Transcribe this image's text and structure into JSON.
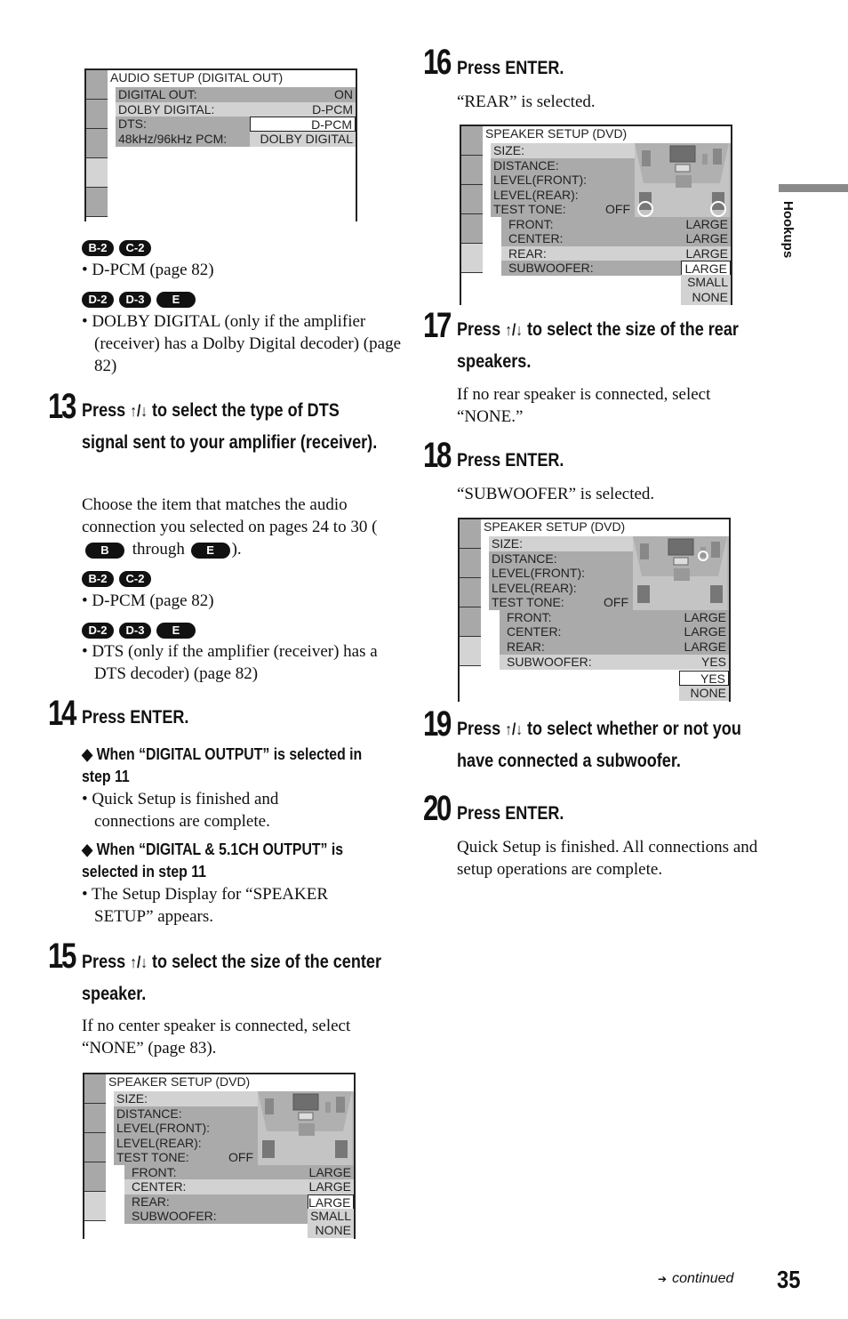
{
  "page": {
    "section_tab": "Hookups",
    "page_number": "35",
    "continued": "continued",
    "continued_arrow": "➔"
  },
  "osd_audio": {
    "title": "AUDIO SETUP (DIGITAL OUT)",
    "rows": [
      {
        "label": "DIGITAL OUT:",
        "value": "ON"
      },
      {
        "label": "DOLBY DIGITAL:",
        "value": "D-PCM"
      },
      {
        "label": "DTS:",
        "value": "D-PCM"
      },
      {
        "label": "48kHz/96kHz PCM:",
        "value": "DOLBY DIGITAL"
      }
    ]
  },
  "left_intro": {
    "group1_badges": [
      "B-2",
      "C-2"
    ],
    "group1_text": "• D-PCM (page 82)",
    "group2_badges": [
      "D-2",
      "D-3",
      "E"
    ],
    "group2_text": "• DOLBY DIGITAL (only if the amplifier (receiver) has a Dolby Digital decoder) (page 82)"
  },
  "step13": {
    "num": "13",
    "heading_pre": "Press ",
    "arrows": "↑/↓",
    "heading_post": " to select the type of DTS signal sent to your amplifier (receiver).",
    "body_pre": "Choose the item that matches the audio connection you selected on pages 24 to 30 (",
    "badge_from": "B",
    "body_mid": " through ",
    "badge_to": "E",
    "body_post": ").",
    "group1_badges": [
      "B-2",
      "C-2"
    ],
    "group1_text": "• D-PCM (page 82)",
    "group2_badges": [
      "D-2",
      "D-3",
      "E"
    ],
    "group2_text": "• DTS (only if the amplifier (receiver) has a DTS decoder) (page 82)"
  },
  "step14": {
    "num": "14",
    "heading": "Press ENTER.",
    "case1_head": "◆ When “DIGITAL OUTPUT” is selected in step 11",
    "case1_text": "• Quick Setup is finished and connections are complete.",
    "case2_head": "◆ When “DIGITAL & 5.1CH OUTPUT” is selected in step 11",
    "case2_text": "• The Setup Display for “SPEAKER SETUP” appears."
  },
  "step15": {
    "num": "15",
    "heading_pre": "Press ",
    "arrows": "↑/↓",
    "heading_post": " to select the size of the center speaker.",
    "body": "If no center speaker is connected, select “NONE” (page 83)."
  },
  "osd_speaker_common": {
    "title": "SPEAKER SETUP (DVD)",
    "menu": [
      "SIZE:",
      "DISTANCE:",
      "LEVEL(FRONT):",
      "LEVEL(REAR):",
      "TEST TONE:"
    ],
    "test_tone_value": "OFF",
    "sub_labels": [
      "FRONT:",
      "CENTER:",
      "REAR:",
      "SUBWOOFER:"
    ]
  },
  "osd_center": {
    "sub_values": [
      "LARGE",
      "LARGE",
      "LARGE",
      ""
    ],
    "options": [
      "LARGE",
      "SMALL",
      "NONE"
    ],
    "selected_option": "LARGE"
  },
  "step16": {
    "num": "16",
    "heading": "Press ENTER.",
    "body": "“REAR” is selected."
  },
  "osd_rear": {
    "sub_values": [
      "LARGE",
      "LARGE",
      "LARGE",
      ""
    ],
    "options": [
      "LARGE",
      "SMALL",
      "NONE"
    ],
    "selected_option": "LARGE"
  },
  "step17": {
    "num": "17",
    "heading_pre": "Press ",
    "arrows": "↑/↓",
    "heading_post": " to select the size of the rear speakers.",
    "body": "If no rear speaker is connected, select “NONE.”"
  },
  "step18": {
    "num": "18",
    "heading": "Press ENTER.",
    "body": "“SUBWOOFER” is selected."
  },
  "osd_sub": {
    "sub_values": [
      "LARGE",
      "LARGE",
      "LARGE",
      "YES"
    ],
    "options": [
      "YES",
      "NONE"
    ],
    "selected_option": "YES"
  },
  "step19": {
    "num": "19",
    "heading_pre": "Press ",
    "arrows": "↑/↓",
    "heading_post": " to select whether or not you have connected a subwoofer."
  },
  "step20": {
    "num": "20",
    "heading": "Press ENTER.",
    "body": "Quick Setup is finished. All connections and setup operations are complete."
  }
}
